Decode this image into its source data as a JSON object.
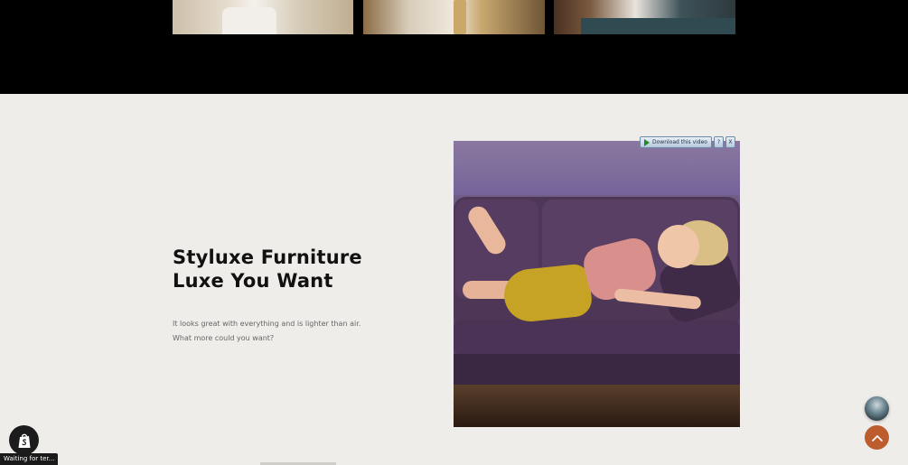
{
  "hero": {
    "heading_line1": "Styluxe Furniture",
    "heading_line2": "Luxe You Want",
    "description_line1": "It looks great with everything and is lighter than air.",
    "description_line2": "What more could you want?"
  },
  "video_overlay": {
    "download_label": "Download this video",
    "help_label": "?",
    "close_label": "X"
  },
  "status_bar": {
    "text": "Waiting for ter..."
  },
  "colors": {
    "top_band": "#000000",
    "section_bg": "#efedea",
    "scroll_top_button": "#bd5d2e",
    "heading": "#111111"
  },
  "icons": {
    "shopify": "shopify-bag-icon",
    "scroll_top": "chevron-up-icon",
    "play": "play-icon"
  }
}
